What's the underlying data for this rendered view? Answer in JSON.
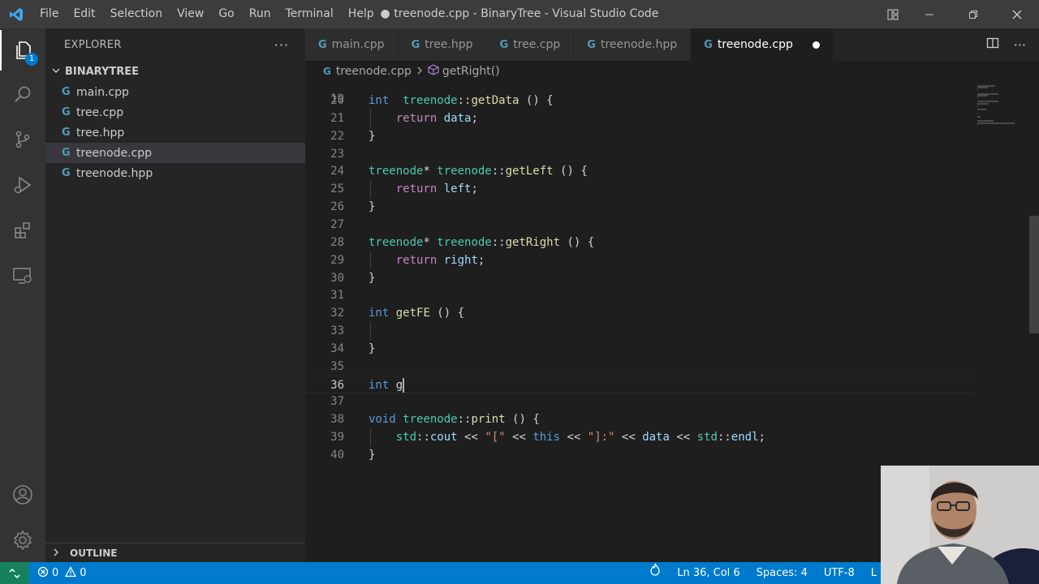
{
  "window": {
    "title": "● treenode.cpp - BinaryTree - Visual Studio Code",
    "menu": [
      "File",
      "Edit",
      "Selection",
      "View",
      "Go",
      "Run",
      "Terminal",
      "Help"
    ]
  },
  "activity_bar": {
    "explorer_badge": "1",
    "icons": [
      "files-icon",
      "search-icon",
      "source-control-icon",
      "run-debug-icon",
      "extensions-icon",
      "remote-explorer-icon",
      "account-icon",
      "settings-gear-icon"
    ]
  },
  "sidebar": {
    "title": "EXPLORER",
    "more": "···",
    "folder": "BINARYTREE",
    "files": [
      "main.cpp",
      "tree.cpp",
      "tree.hpp",
      "treenode.cpp",
      "treenode.hpp"
    ],
    "selected_file": "treenode.cpp",
    "outline": "OUTLINE"
  },
  "tabs": [
    {
      "label": "main.cpp",
      "active": false
    },
    {
      "label": "tree.hpp",
      "active": false
    },
    {
      "label": "tree.cpp",
      "active": false
    },
    {
      "label": "treenode.hpp",
      "active": false
    },
    {
      "label": "treenode.cpp",
      "active": true,
      "dirty": true
    }
  ],
  "breadcrumb": {
    "file": "treenode.cpp",
    "symbol": "getRight()"
  },
  "editor": {
    "current_line": 36,
    "partial_line": "19",
    "lines": [
      {
        "n": "20",
        "tokens": [
          [
            "kw",
            "int"
          ],
          [
            "",
            "  "
          ],
          [
            "ty",
            "treenode"
          ],
          [
            "",
            "::"
          ],
          [
            "fn",
            "getData"
          ],
          [
            "",
            " () {"
          ]
        ]
      },
      {
        "n": "21",
        "tokens": [
          [
            "",
            "    "
          ],
          [
            "ctl",
            "return"
          ],
          [
            "",
            ""
          ],
          [
            "var",
            " data"
          ],
          [
            "",
            ";"
          ]
        ]
      },
      {
        "n": "22",
        "tokens": [
          [
            "",
            "}"
          ]
        ]
      },
      {
        "n": "23",
        "tokens": []
      },
      {
        "n": "24",
        "tokens": [
          [
            "ty",
            "treenode"
          ],
          [
            "",
            "* "
          ],
          [
            "ty",
            "treenode"
          ],
          [
            "",
            "::"
          ],
          [
            "fn",
            "getLeft"
          ],
          [
            "",
            " () {"
          ]
        ]
      },
      {
        "n": "25",
        "tokens": [
          [
            "",
            "    "
          ],
          [
            "ctl",
            "return"
          ],
          [
            "var",
            " left"
          ],
          [
            "",
            ";"
          ]
        ]
      },
      {
        "n": "26",
        "tokens": [
          [
            "",
            "}"
          ]
        ]
      },
      {
        "n": "27",
        "tokens": []
      },
      {
        "n": "28",
        "tokens": [
          [
            "ty",
            "treenode"
          ],
          [
            "",
            "* "
          ],
          [
            "ty",
            "treenode"
          ],
          [
            "",
            "::"
          ],
          [
            "fn",
            "getRight"
          ],
          [
            "",
            " () {"
          ]
        ]
      },
      {
        "n": "29",
        "tokens": [
          [
            "",
            "    "
          ],
          [
            "ctl",
            "return"
          ],
          [
            "var",
            " right"
          ],
          [
            "",
            ";"
          ]
        ]
      },
      {
        "n": "30",
        "tokens": [
          [
            "",
            "}"
          ]
        ]
      },
      {
        "n": "31",
        "tokens": []
      },
      {
        "n": "32",
        "tokens": [
          [
            "kw",
            "int"
          ],
          [
            "fn",
            " getFE"
          ],
          [
            "",
            " () {"
          ]
        ]
      },
      {
        "n": "33",
        "tokens": []
      },
      {
        "n": "34",
        "tokens": [
          [
            "",
            "}"
          ]
        ]
      },
      {
        "n": "35",
        "tokens": []
      },
      {
        "n": "36",
        "tokens": [
          [
            "kw",
            "int"
          ],
          [
            "",
            " g"
          ]
        ]
      },
      {
        "n": "37",
        "tokens": []
      },
      {
        "n": "38",
        "tokens": [
          [
            "kw",
            "void"
          ],
          [
            "",
            " "
          ],
          [
            "ty",
            "treenode"
          ],
          [
            "",
            "::"
          ],
          [
            "fn",
            "print"
          ],
          [
            "",
            " () {"
          ]
        ]
      },
      {
        "n": "39",
        "tokens": [
          [
            "",
            "    "
          ],
          [
            "ty",
            "std"
          ],
          [
            "",
            "::"
          ],
          [
            "var",
            "cout"
          ],
          [
            "",
            " << "
          ],
          [
            "str",
            "\"[\""
          ],
          [
            "",
            " << "
          ],
          [
            "kw",
            "this"
          ],
          [
            "",
            " << "
          ],
          [
            "str",
            "\"]:\""
          ],
          [
            "",
            " << "
          ],
          [
            "var",
            "data"
          ],
          [
            "",
            " << "
          ],
          [
            "ty",
            "std"
          ],
          [
            "",
            "::"
          ],
          [
            "var",
            "endl"
          ],
          [
            "",
            ";"
          ]
        ]
      },
      {
        "n": "40",
        "tokens": [
          [
            "",
            "}"
          ]
        ]
      }
    ]
  },
  "statusbar": {
    "errors": "0",
    "warnings": "0",
    "position": "Ln 36, Col 6",
    "spaces": "Spaces: 4",
    "encoding": "UTF-8",
    "eol": "L"
  },
  "colors": {
    "accent": "#007acc",
    "remote": "#16825d",
    "keyword": "#569cd6",
    "type": "#4ec9b0",
    "function": "#dcdcaa",
    "variable": "#9cdcfe",
    "control": "#c586c0",
    "string": "#ce9178"
  }
}
